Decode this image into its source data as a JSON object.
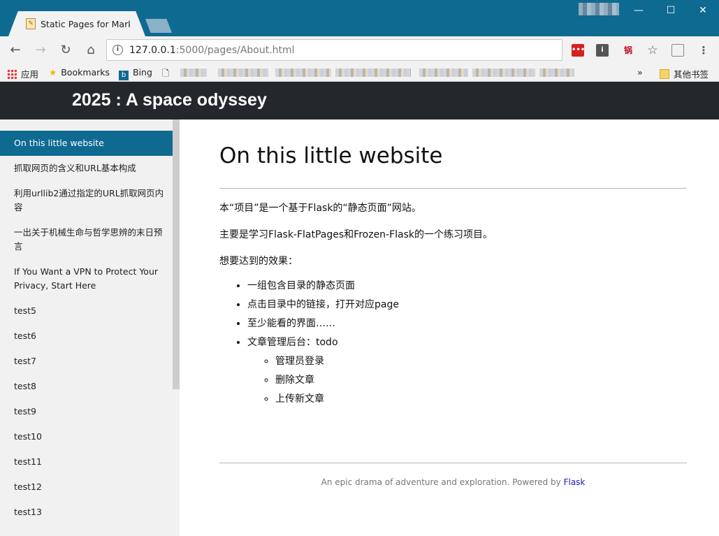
{
  "browser": {
    "tab_title": "Static Pages for Marko",
    "url_host": "127.0.0.1",
    "url_rest": ":5000/pages/About.html",
    "bookmarks": {
      "apps_label": "应用",
      "bookmarks_label": "Bookmarks",
      "bing_label": "Bing",
      "other_label": "其他书签",
      "overflow": "»"
    },
    "ext_label": "锅"
  },
  "site": {
    "title": "2025 : A space odyssey"
  },
  "sidebar": {
    "items": [
      {
        "label": "On this little website",
        "active": true
      },
      {
        "label": "抓取网页的含义和URL基本构成"
      },
      {
        "label": "利用urllib2通过指定的URL抓取网页内容"
      },
      {
        "label": "一出关于机械生命与哲学思辨的末日预言"
      },
      {
        "label": "If You Want a VPN to Protect Your Privacy, Start Here"
      },
      {
        "label": "test5"
      },
      {
        "label": "test6"
      },
      {
        "label": "test7"
      },
      {
        "label": "test8"
      },
      {
        "label": "test9"
      },
      {
        "label": "test10"
      },
      {
        "label": "test11"
      },
      {
        "label": "test12"
      },
      {
        "label": "test13"
      }
    ]
  },
  "main": {
    "title": "On this little website",
    "paragraphs": [
      "本“项目”是一个基于Flask的“静态页面”网站。",
      "主要是学习Flask-FlatPages和Frozen-Flask的一个练习项目。",
      "想要达到的效果："
    ],
    "list": [
      "一组包含目录的静态页面",
      "点击目录中的链接，打开对应page",
      "至少能看的界面……",
      "文章管理后台：todo"
    ],
    "sublist": [
      "管理员登录",
      "删除文章",
      "上传新文章"
    ]
  },
  "footer": {
    "text": "An epic drama of adventure and exploration. Powered by ",
    "link": "Flask"
  },
  "colors": {
    "titlebar": "#0f6a91",
    "header": "#24282c",
    "sidebar_active": "#0f6a91"
  }
}
